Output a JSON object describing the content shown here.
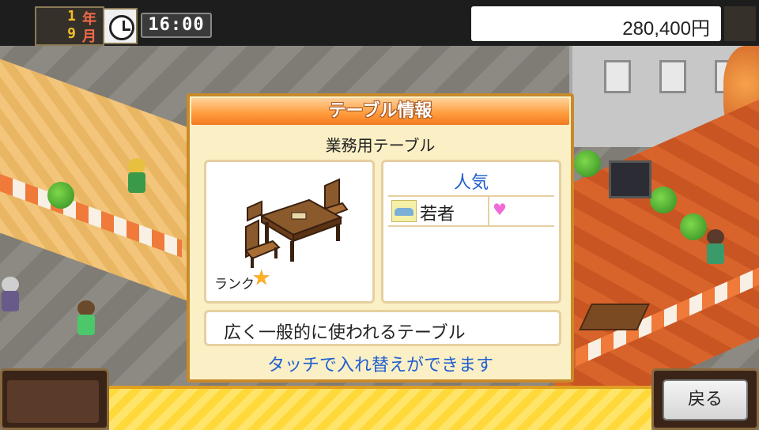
{
  "hud": {
    "year_value": "1",
    "year_unit": "年",
    "month_value": "9",
    "month_unit": "月",
    "clock_icon": "clock-icon",
    "time": "16:00",
    "money": "280,400円"
  },
  "dialog": {
    "title": "テーブル情報",
    "item_name": "業務用テーブル",
    "rank_label": "ランク",
    "rank_icon": "star-icon",
    "popularity_title": "人気",
    "popularity_items": [
      {
        "label": "若者",
        "icon": "customer-type-icon",
        "affinity_icon": "heart-icon"
      }
    ],
    "description": "広く一般的に使われるテーブル",
    "touch_hint": "タッチで入れ替えができます"
  },
  "buttons": {
    "back_label": "戻る"
  },
  "colors": {
    "header_orange": "#ff9a3a",
    "accent_blue": "#1f5fd0",
    "message_bar_yellow": "#ffd93a"
  }
}
